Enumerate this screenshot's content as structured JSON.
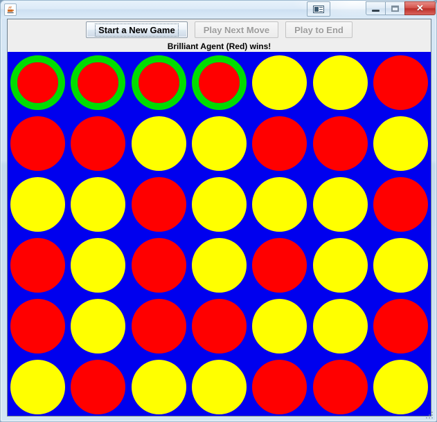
{
  "window": {
    "app_icon": "java-coffee-cup-icon",
    "title": "",
    "controls": {
      "aux": "window-layout-icon",
      "minimize": "minimize-icon",
      "maximize": "maximize-icon",
      "close": "✕"
    }
  },
  "toolbar": {
    "buttons": [
      {
        "label": "Start a New Game",
        "enabled": true,
        "focused": true
      },
      {
        "label": "Play Next Move",
        "enabled": false,
        "focused": false
      },
      {
        "label": "Play to End",
        "enabled": false,
        "focused": false
      }
    ]
  },
  "status": {
    "message": "Brilliant Agent (Red) wins!"
  },
  "colors": {
    "board": "#0000ee",
    "red": "#ff0000",
    "yellow": "#ffff00",
    "win_highlight": "#00dd00",
    "panel": "#eeeeee"
  },
  "board": {
    "rows": 6,
    "columns": 7,
    "legend": {
      "R": "red",
      "Y": "yellow",
      "": "empty"
    },
    "win_marker": "*",
    "cells": [
      [
        "R*",
        "R*",
        "R*",
        "R*",
        "Y",
        "Y",
        "R"
      ],
      [
        "R",
        "R",
        "Y",
        "Y",
        "R",
        "R",
        "Y"
      ],
      [
        "Y",
        "Y",
        "R",
        "Y",
        "Y",
        "Y",
        "R"
      ],
      [
        "R",
        "Y",
        "R",
        "Y",
        "R",
        "Y",
        "Y"
      ],
      [
        "R",
        "Y",
        "R",
        "R",
        "Y",
        "Y",
        "R"
      ],
      [
        "Y",
        "R",
        "Y",
        "Y",
        "R",
        "R",
        "Y"
      ]
    ]
  }
}
